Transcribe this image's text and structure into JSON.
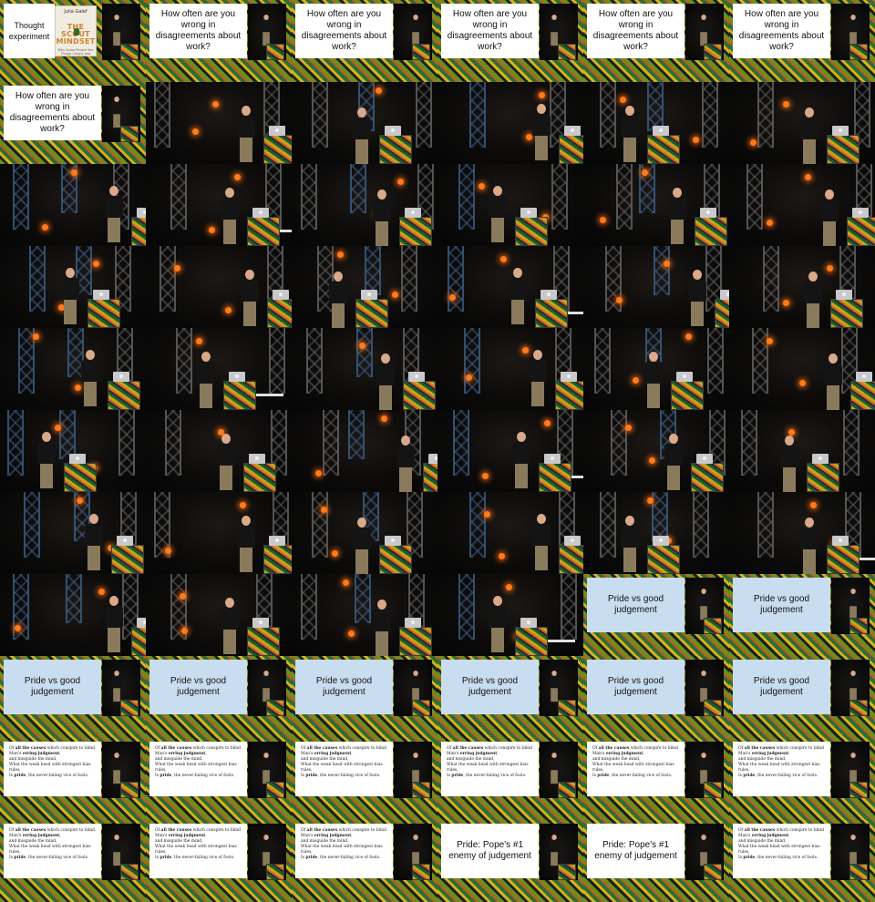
{
  "title": "",
  "slides": {
    "thought_experiment": "Thought experiment",
    "book": {
      "author": "Julia Galef",
      "title": "THE SCOUT MINDSET",
      "subtitle": "Why Some People See Things Clearly and Others Don't"
    },
    "question": "How often are you wrong in disagreements about work?",
    "pride": "Pride vs good judgement",
    "poem_lines": [
      [
        "Of ",
        "all the causes",
        " which conspire to blind"
      ],
      [
        "Man's ",
        "erring judgment",
        ","
      ],
      [
        "and misguide the mind,"
      ],
      [
        "What the weak head with strongest bias rules,"
      ],
      [
        "Is ",
        "pride",
        ", the never-failing vice of fools."
      ]
    ],
    "pope": "Pride: Pope's #1 enemy of judgement"
  },
  "frames": [
    {
      "kind": "book"
    },
    {
      "kind": "question"
    },
    {
      "kind": "question"
    },
    {
      "kind": "question"
    },
    {
      "kind": "question"
    },
    {
      "kind": "question"
    },
    {
      "kind": "question"
    },
    {
      "kind": "stage"
    },
    {
      "kind": "stage"
    },
    {
      "kind": "stage"
    },
    {
      "kind": "stage"
    },
    {
      "kind": "stage"
    },
    {
      "kind": "stage"
    },
    {
      "kind": "stage"
    },
    {
      "kind": "stage"
    },
    {
      "kind": "stage"
    },
    {
      "kind": "stage"
    },
    {
      "kind": "stage"
    },
    {
      "kind": "stage"
    },
    {
      "kind": "stage"
    },
    {
      "kind": "stage"
    },
    {
      "kind": "stage"
    },
    {
      "kind": "stage"
    },
    {
      "kind": "stage"
    },
    {
      "kind": "stage"
    },
    {
      "kind": "stage"
    },
    {
      "kind": "stage"
    },
    {
      "kind": "stage"
    },
    {
      "kind": "stage"
    },
    {
      "kind": "stage"
    },
    {
      "kind": "stage"
    },
    {
      "kind": "stage"
    },
    {
      "kind": "stage"
    },
    {
      "kind": "stage"
    },
    {
      "kind": "stage"
    },
    {
      "kind": "stage"
    },
    {
      "kind": "stage"
    },
    {
      "kind": "stage"
    },
    {
      "kind": "stage"
    },
    {
      "kind": "stage"
    },
    {
      "kind": "stage"
    },
    {
      "kind": "stage"
    },
    {
      "kind": "stage"
    },
    {
      "kind": "stage"
    },
    {
      "kind": "stage"
    },
    {
      "kind": "stage"
    },
    {
      "kind": "pride"
    },
    {
      "kind": "pride"
    },
    {
      "kind": "pride"
    },
    {
      "kind": "pride"
    },
    {
      "kind": "pride"
    },
    {
      "kind": "pride"
    },
    {
      "kind": "pride"
    },
    {
      "kind": "pride"
    },
    {
      "kind": "poem"
    },
    {
      "kind": "poem"
    },
    {
      "kind": "poem"
    },
    {
      "kind": "poem"
    },
    {
      "kind": "poem"
    },
    {
      "kind": "poem"
    },
    {
      "kind": "poem"
    },
    {
      "kind": "poem"
    },
    {
      "kind": "poem"
    },
    {
      "kind": "pope"
    },
    {
      "kind": "pope"
    },
    {
      "kind": "poem"
    }
  ]
}
